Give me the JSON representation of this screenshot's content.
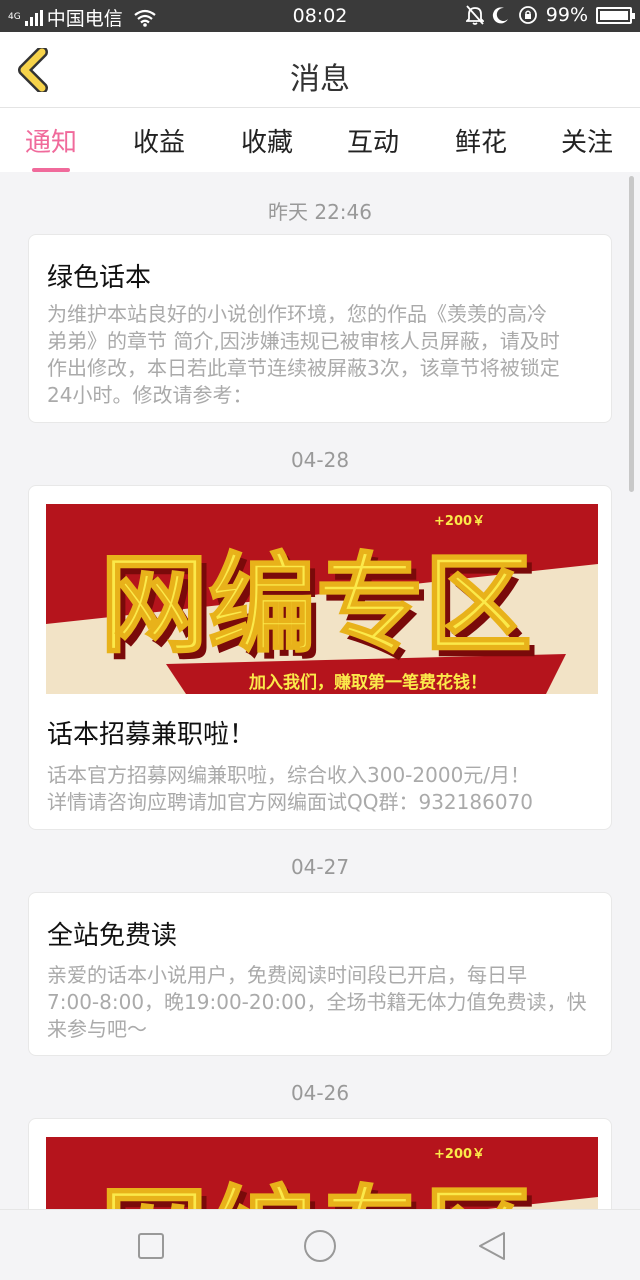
{
  "status_bar": {
    "network_type": "4G",
    "carrier": "中国电信",
    "time": "08:02",
    "battery_percent": "99%",
    "battery_level": 0.99,
    "icons": [
      "signal-icon",
      "wifi-icon",
      "mute-bell-icon",
      "moon-icon",
      "rotation-lock-icon",
      "battery-icon"
    ]
  },
  "header": {
    "title": "消息"
  },
  "tabs": [
    {
      "label": "通知",
      "active": true
    },
    {
      "label": "收益",
      "active": false
    },
    {
      "label": "收藏",
      "active": false
    },
    {
      "label": "互动",
      "active": false
    },
    {
      "label": "鲜花",
      "active": false
    },
    {
      "label": "关注",
      "active": false
    }
  ],
  "messages": [
    {
      "date": "昨天 22:46",
      "title": "绿色话本",
      "body_lines": [
        "为维护本站良好的小说创作环境，您的作品《羡羡的高冷",
        "弟弟》的章节 简介,因涉嫌违规已被审核人员屏蔽，请及时",
        "作出修改，本日若此章节连续被屏蔽3次，该章节将被锁定",
        "24小时。修改请参考："
      ]
    },
    {
      "date": "04-28",
      "banner": {
        "headline": "网编专区",
        "tag": "+200￥",
        "slogan": "加入我们，赚取第一笔费花钱！"
      },
      "title": "话本招募兼职啦！",
      "body_lines": [
        "话本官方招募网编兼职啦，综合收入300-2000元/月！",
        "详情请咨询应聘请加官方网编面试QQ群：932186070"
      ]
    },
    {
      "date": "04-27",
      "title": "全站免费读",
      "body_lines": [
        "亲爱的话本小说用户，免费阅读时间段已开启，每日早",
        "7:00-8:00，晚19:00-20:00，全场书籍无体力值免费读，快",
        "来参与吧～"
      ]
    },
    {
      "date": "04-26",
      "banner": {
        "headline": "网编专区",
        "tag": "+200￥"
      }
    }
  ],
  "colors": {
    "accent": "#f06a9b",
    "back_arrow": "#f7d34a",
    "banner_red": "#b5141c",
    "banner_yellow": "#fbe94a"
  }
}
